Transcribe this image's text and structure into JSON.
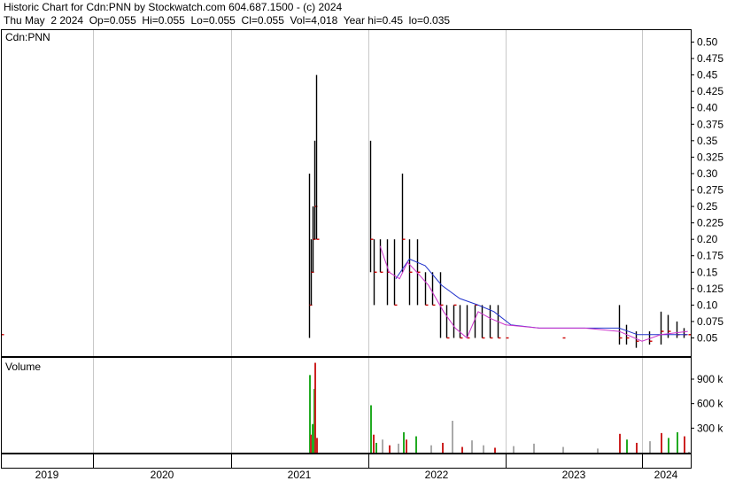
{
  "header": {
    "line1": "Historic Chart for Cdn:PNN by Stockwatch.com 604.687.1500 - (c) 2024",
    "line2": "Thu May  2 2024  Op=0.055  Hi=0.055  Lo=0.055  Cl=0.055  Vol=4,018  Year hi=0.45  lo=0.035"
  },
  "price_panel": {
    "label": "Cdn:PNN"
  },
  "volume_panel": {
    "label": "Volume"
  },
  "colors": {
    "up_volume": "#22aa22",
    "down_volume": "#cc2222",
    "flat_volume": "#aaaaaa",
    "ma_short": "#cc33cc",
    "ma_long": "#2233cc",
    "close_marker": "#cc0000",
    "grid": "#c8c8c8"
  },
  "chart_data": [
    {
      "type": "ohlc",
      "series_label": "Cdn:PNN",
      "x_years": [
        "2019",
        "2020",
        "2021",
        "2022",
        "2023",
        "2024"
      ],
      "y_ticks": [
        "0.50",
        "0.475",
        "0.45",
        "0.425",
        "0.40",
        "0.375",
        "0.35",
        "0.325",
        "0.30",
        "0.275",
        "0.25",
        "0.225",
        "0.20",
        "0.175",
        "0.15",
        "0.125",
        "0.10",
        "0.075",
        "0.05"
      ],
      "ylim": [
        0.035,
        0.51
      ],
      "bars": [
        {
          "date": "2019-01-01",
          "high": 0.055,
          "low": 0.055,
          "close": 0.055
        },
        {
          "date": "2021-07-27",
          "high": 0.3,
          "low": 0.05,
          "close": 0.1
        },
        {
          "date": "2021-08-01",
          "high": 0.2,
          "low": 0.1,
          "close": 0.15
        },
        {
          "date": "2021-08-05",
          "high": 0.25,
          "low": 0.15,
          "close": 0.2
        },
        {
          "date": "2021-08-10",
          "high": 0.35,
          "low": 0.2,
          "close": 0.25
        },
        {
          "date": "2021-08-14",
          "high": 0.45,
          "low": 0.2,
          "close": 0.2
        },
        {
          "date": "2022-01-05",
          "high": 0.35,
          "low": 0.15,
          "close": 0.2
        },
        {
          "date": "2022-01-15",
          "high": 0.2,
          "low": 0.1,
          "close": 0.15
        },
        {
          "date": "2022-02-01",
          "high": 0.2,
          "low": 0.15,
          "close": 0.15
        },
        {
          "date": "2022-02-20",
          "high": 0.2,
          "low": 0.1,
          "close": 0.15
        },
        {
          "date": "2022-03-10",
          "high": 0.2,
          "low": 0.1,
          "close": 0.1
        },
        {
          "date": "2022-04-01",
          "high": 0.3,
          "low": 0.15,
          "close": 0.2
        },
        {
          "date": "2022-04-20",
          "high": 0.2,
          "low": 0.1,
          "close": 0.15
        },
        {
          "date": "2022-05-10",
          "high": 0.2,
          "low": 0.1,
          "close": 0.15
        },
        {
          "date": "2022-06-01",
          "high": 0.15,
          "low": 0.1,
          "close": 0.1
        },
        {
          "date": "2022-06-20",
          "high": 0.15,
          "low": 0.1,
          "close": 0.1
        },
        {
          "date": "2022-07-10",
          "high": 0.15,
          "low": 0.05,
          "close": 0.1
        },
        {
          "date": "2022-07-28",
          "high": 0.1,
          "low": 0.05,
          "close": 0.05
        },
        {
          "date": "2022-08-15",
          "high": 0.1,
          "low": 0.05,
          "close": 0.1
        },
        {
          "date": "2022-09-01",
          "high": 0.1,
          "low": 0.05,
          "close": 0.05
        },
        {
          "date": "2022-09-20",
          "high": 0.1,
          "low": 0.05,
          "close": 0.05
        },
        {
          "date": "2022-10-10",
          "high": 0.1,
          "low": 0.05,
          "close": 0.1
        },
        {
          "date": "2022-10-30",
          "high": 0.1,
          "low": 0.05,
          "close": 0.05
        },
        {
          "date": "2022-11-20",
          "high": 0.1,
          "low": 0.05,
          "close": 0.05
        },
        {
          "date": "2022-12-10",
          "high": 0.1,
          "low": 0.05,
          "close": 0.05
        },
        {
          "date": "2023-01-01",
          "high": 0.05,
          "low": 0.05,
          "close": 0.05
        },
        {
          "date": "2023-06-01",
          "high": 0.05,
          "low": 0.05,
          "close": 0.05
        },
        {
          "date": "2023-11-01",
          "high": 0.1,
          "low": 0.04,
          "close": 0.05
        },
        {
          "date": "2023-11-20",
          "high": 0.07,
          "low": 0.04,
          "close": 0.05
        },
        {
          "date": "2023-12-15",
          "high": 0.06,
          "low": 0.035,
          "close": 0.045
        },
        {
          "date": "2024-01-20",
          "high": 0.06,
          "low": 0.04,
          "close": 0.045
        },
        {
          "date": "2024-02-20",
          "high": 0.09,
          "low": 0.04,
          "close": 0.06
        },
        {
          "date": "2024-03-10",
          "high": 0.085,
          "low": 0.05,
          "close": 0.06
        },
        {
          "date": "2024-04-01",
          "high": 0.075,
          "low": 0.05,
          "close": 0.055
        },
        {
          "date": "2024-04-20",
          "high": 0.065,
          "low": 0.05,
          "close": 0.055
        },
        {
          "date": "2024-05-02",
          "high": 0.055,
          "low": 0.055,
          "close": 0.055
        }
      ],
      "ma_short": {
        "dates": [
          "2022-02-01",
          "2022-02-25",
          "2022-03-25",
          "2022-04-15",
          "2022-05-10",
          "2022-06-10",
          "2022-07-20",
          "2022-08-20",
          "2022-09-20",
          "2022-10-20",
          "2022-11-20",
          "2023-01-01",
          "2023-04-01",
          "2023-08-01",
          "2023-11-01",
          "2024-01-01",
          "2024-02-20",
          "2024-05-02"
        ],
        "values": [
          0.19,
          0.15,
          0.14,
          0.165,
          0.15,
          0.13,
          0.09,
          0.065,
          0.05,
          0.09,
          0.08,
          0.07,
          0.065,
          0.065,
          0.06,
          0.045,
          0.055,
          0.06
        ]
      },
      "ma_long": {
        "dates": [
          "2022-03-15",
          "2022-04-20",
          "2022-06-01",
          "2022-07-15",
          "2022-09-01",
          "2022-10-20",
          "2022-12-01",
          "2023-01-15",
          "2023-04-01",
          "2023-08-01",
          "2023-11-01",
          "2023-12-20",
          "2024-02-20",
          "2024-05-02"
        ],
        "values": [
          0.14,
          0.17,
          0.16,
          0.13,
          0.11,
          0.1,
          0.09,
          0.07,
          0.065,
          0.065,
          0.065,
          0.055,
          0.055,
          0.055
        ]
      }
    },
    {
      "type": "bar",
      "series_label": "Volume",
      "y_ticks": [
        "900 k",
        "600 k",
        "300 k"
      ],
      "ylim": [
        0,
        1100000
      ],
      "bars": [
        {
          "date": "2021-07-27",
          "value": 950000,
          "dir": "up"
        },
        {
          "date": "2021-07-30",
          "value": 220000,
          "dir": "down"
        },
        {
          "date": "2021-08-03",
          "value": 350000,
          "dir": "up"
        },
        {
          "date": "2021-08-07",
          "value": 780000,
          "dir": "up"
        },
        {
          "date": "2021-08-10",
          "value": 1100000,
          "dir": "down"
        },
        {
          "date": "2021-08-14",
          "value": 180000,
          "dir": "down"
        },
        {
          "date": "2022-01-05",
          "value": 580000,
          "dir": "up"
        },
        {
          "date": "2022-01-12",
          "value": 220000,
          "dir": "down"
        },
        {
          "date": "2022-01-20",
          "value": 120000,
          "dir": "up"
        },
        {
          "date": "2022-02-05",
          "value": 160000,
          "dir": "flat"
        },
        {
          "date": "2022-02-25",
          "value": 90000,
          "dir": "down"
        },
        {
          "date": "2022-03-20",
          "value": 110000,
          "dir": "flat"
        },
        {
          "date": "2022-04-02",
          "value": 250000,
          "dir": "up"
        },
        {
          "date": "2022-04-10",
          "value": 160000,
          "dir": "down"
        },
        {
          "date": "2022-05-05",
          "value": 200000,
          "dir": "up"
        },
        {
          "date": "2022-06-15",
          "value": 90000,
          "dir": "flat"
        },
        {
          "date": "2022-07-15",
          "value": 120000,
          "dir": "down"
        },
        {
          "date": "2022-08-10",
          "value": 390000,
          "dir": "flat"
        },
        {
          "date": "2022-09-05",
          "value": 70000,
          "dir": "down"
        },
        {
          "date": "2022-10-01",
          "value": 150000,
          "dir": "flat"
        },
        {
          "date": "2022-11-01",
          "value": 90000,
          "dir": "flat"
        },
        {
          "date": "2022-12-01",
          "value": 60000,
          "dir": "down"
        },
        {
          "date": "2023-01-20",
          "value": 80000,
          "dir": "flat"
        },
        {
          "date": "2023-03-15",
          "value": 110000,
          "dir": "flat"
        },
        {
          "date": "2023-06-01",
          "value": 70000,
          "dir": "flat"
        },
        {
          "date": "2023-09-01",
          "value": 50000,
          "dir": "flat"
        },
        {
          "date": "2023-11-01",
          "value": 230000,
          "dir": "down"
        },
        {
          "date": "2023-11-20",
          "value": 160000,
          "dir": "up"
        },
        {
          "date": "2023-12-15",
          "value": 120000,
          "dir": "down"
        },
        {
          "date": "2024-01-20",
          "value": 140000,
          "dir": "flat"
        },
        {
          "date": "2024-02-20",
          "value": 240000,
          "dir": "down"
        },
        {
          "date": "2024-03-10",
          "value": 180000,
          "dir": "up"
        },
        {
          "date": "2024-04-01",
          "value": 250000,
          "dir": "up"
        },
        {
          "date": "2024-04-20",
          "value": 200000,
          "dir": "down"
        },
        {
          "date": "2024-05-02",
          "value": 10000,
          "dir": "flat"
        }
      ]
    }
  ]
}
